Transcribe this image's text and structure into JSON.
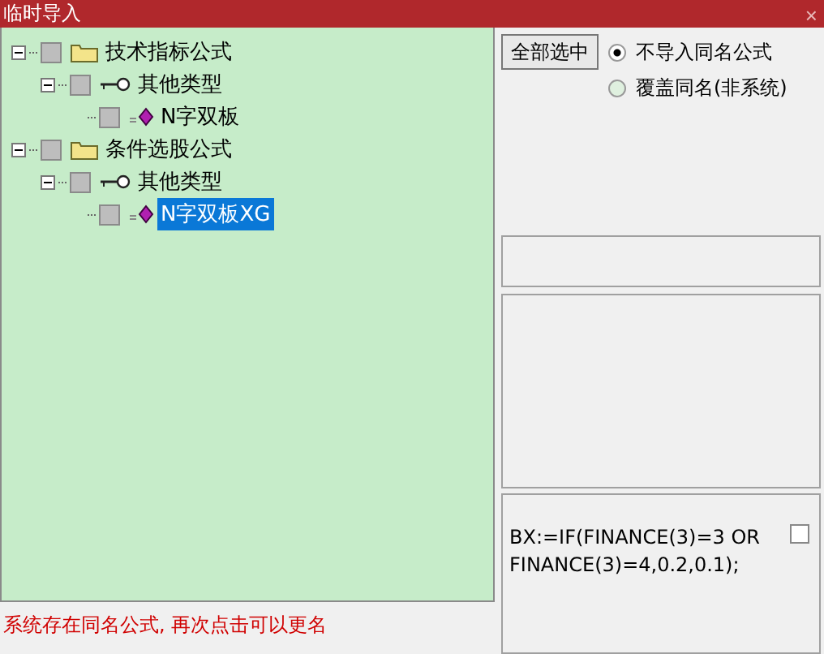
{
  "window": {
    "title": "临时导入",
    "close": "×"
  },
  "tree": [
    {
      "label": "技术指标公式",
      "kind": "folder",
      "expanded": true,
      "checked": false,
      "selected": false,
      "children": [
        {
          "label": "其他类型",
          "kind": "category",
          "expanded": true,
          "checked": false,
          "selected": false,
          "children": [
            {
              "label": "N字双板",
              "kind": "formula",
              "checked": false,
              "selected": false
            }
          ]
        }
      ]
    },
    {
      "label": "条件选股公式",
      "kind": "folder",
      "expanded": true,
      "checked": false,
      "selected": false,
      "children": [
        {
          "label": "其他类型",
          "kind": "category",
          "expanded": true,
          "checked": false,
          "selected": false,
          "children": [
            {
              "label": "N字双板XG",
              "kind": "formula",
              "checked": false,
              "selected": true
            }
          ]
        }
      ]
    }
  ],
  "select_all_button": "全部选中",
  "options": [
    {
      "label": "不导入同名公式",
      "selected": true
    },
    {
      "label": "覆盖同名(非系统)",
      "selected": false
    }
  ],
  "formula_text": {
    "lines": [
      "BX:=IF(FINANCE(3)=3 OR",
      "FINANCE(3)=4,0.2,0.1);"
    ],
    "checked": false
  },
  "status": "系统存在同名公式, 再次点击可以更名"
}
